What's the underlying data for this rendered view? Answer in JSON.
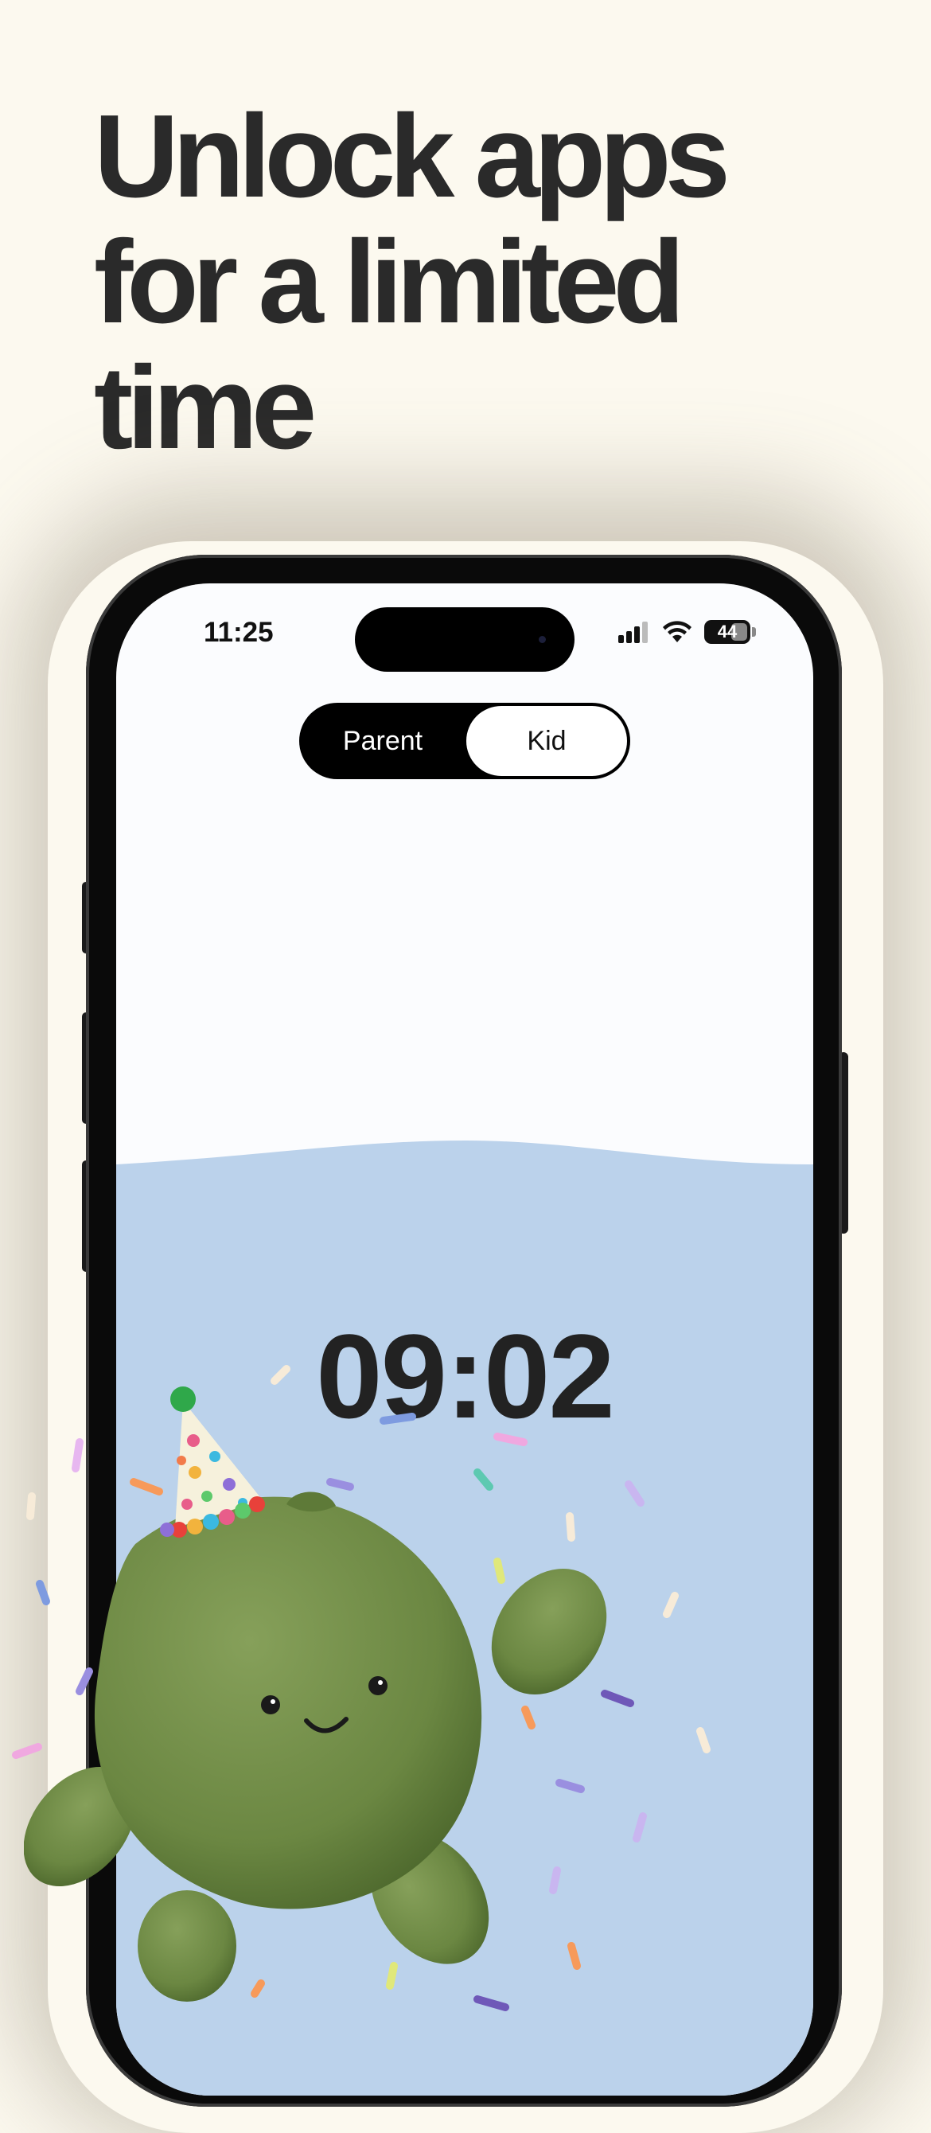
{
  "headline": {
    "lines": [
      "Unlock apps",
      "for a limited",
      "time"
    ]
  },
  "status_bar": {
    "time": "11:25",
    "battery": "44"
  },
  "mode_toggle": {
    "parent_label": "Parent",
    "kid_label": "Kid",
    "selected": "Kid"
  },
  "timer": {
    "value": "09:02"
  },
  "colors": {
    "background": "#FCF9EF",
    "headline": "#2A2A2A",
    "screen": "#FBFCFE",
    "timer_panel": "#BBD2EB",
    "mascot_green": "#6E8A45"
  },
  "icons": [
    "signal-icon",
    "wifi-icon",
    "battery-icon",
    "party-hat-mascot-illustration",
    "confetti-decoration"
  ]
}
